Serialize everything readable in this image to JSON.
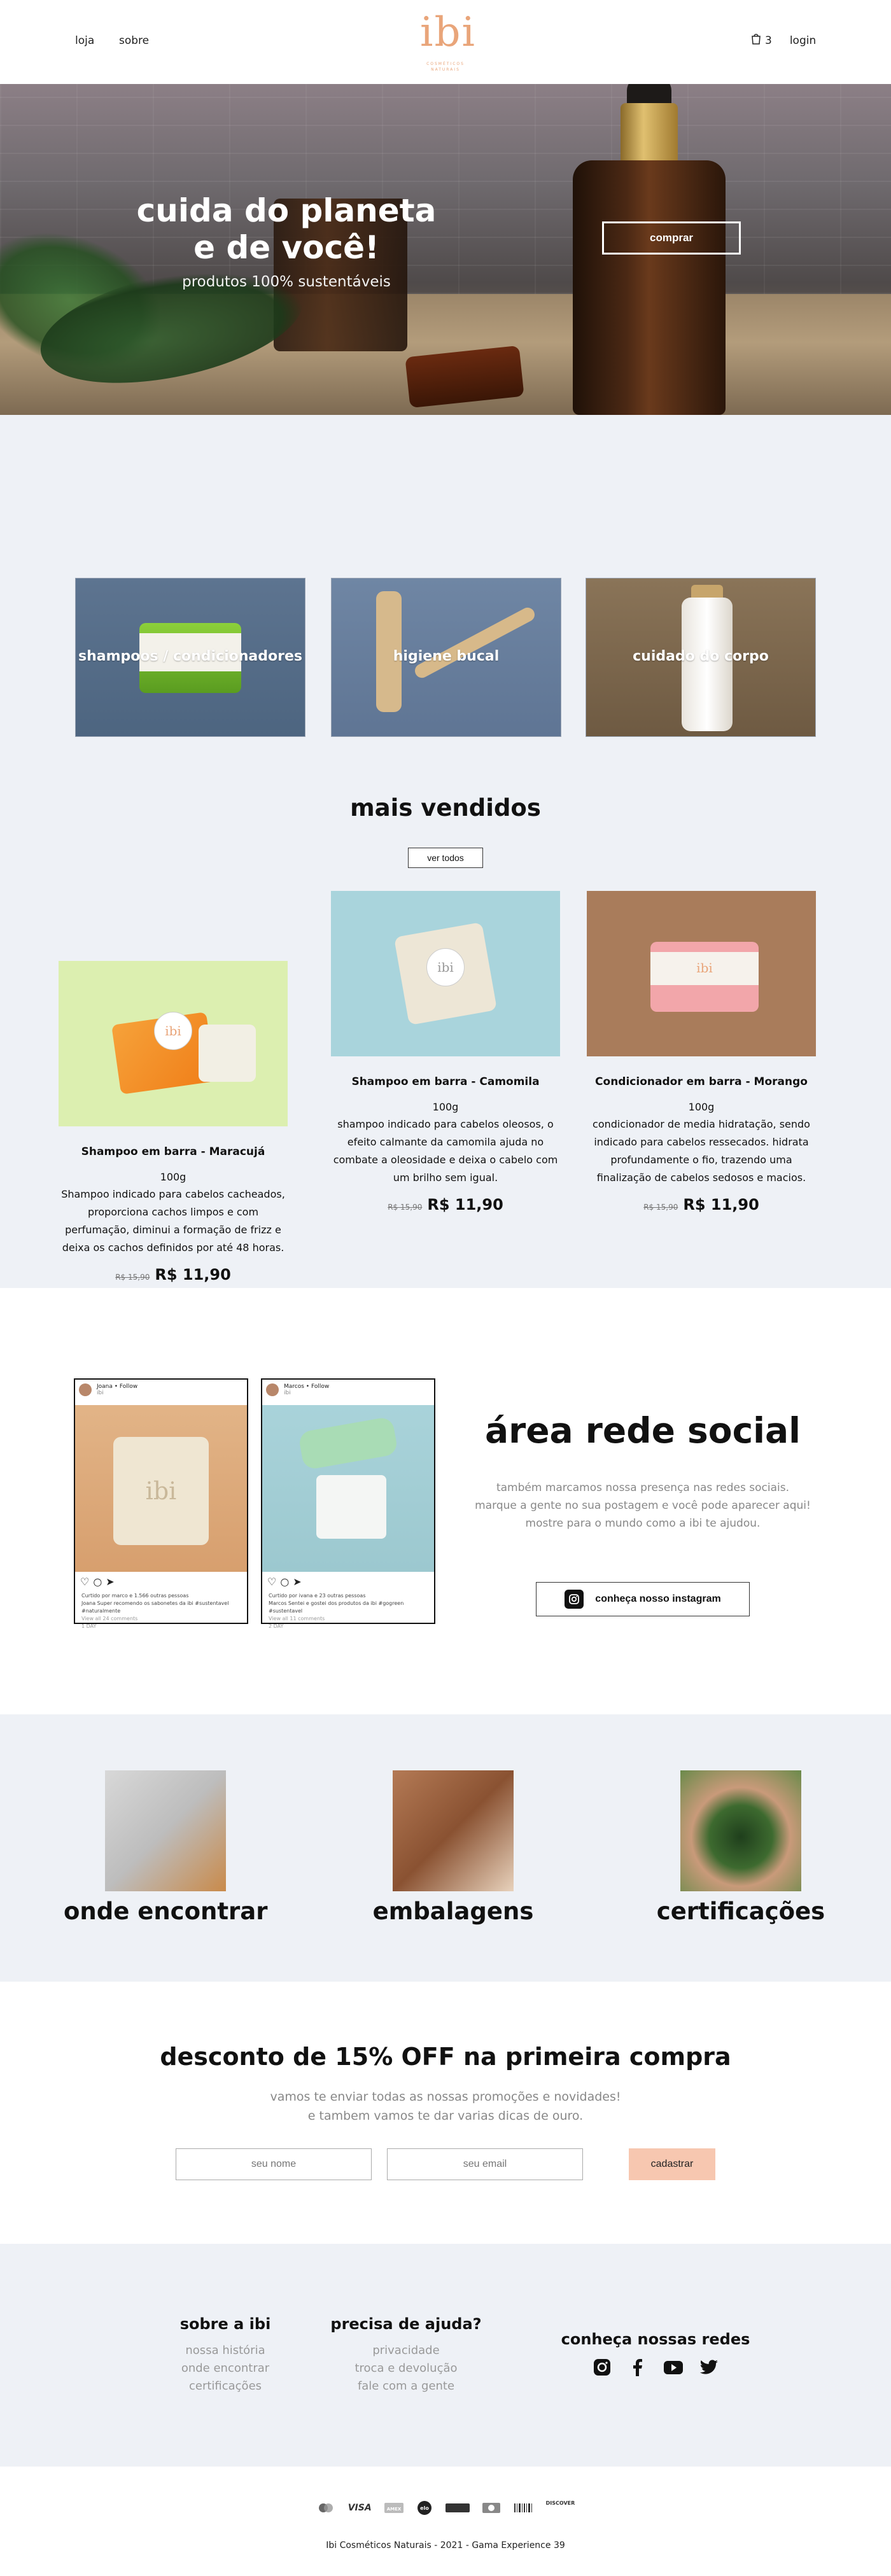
{
  "header": {
    "nav": [
      "loja",
      "sobre"
    ],
    "logo_mark": "ibi",
    "logo_sub": "COSMÉTICOS NATURAIS",
    "cart_count": "3",
    "login": "login"
  },
  "hero": {
    "title_line1": "cuida do planeta",
    "title_line2": "e de você!",
    "subtitle": "produtos 100% sustentáveis",
    "button": "comprar"
  },
  "categories": [
    {
      "label": "shampoos / condicionadores"
    },
    {
      "label": "higiene bucal"
    },
    {
      "label": "cuidado do corpo"
    }
  ],
  "bestsellers": {
    "title": "mais vendidos",
    "button": "ver todos",
    "products": [
      {
        "name": "Shampoo em barra - Maracujá",
        "weight": "100g",
        "desc": "Shampoo indicado para cabelos cacheados, proporciona cachos limpos e com perfumação, diminui a formação de frizz e deixa os cachos definidos por até 48 horas.",
        "old_price": "R$ 15,90",
        "price": "R$ 11,90",
        "tag": "ibi"
      },
      {
        "name": "Shampoo em barra - Camomila",
        "weight": "100g",
        "desc": "shampoo indicado para cabelos oleosos, o efeito calmante da camomila ajuda no combate a oleosidade e deixa o cabelo com um brilho sem igual.",
        "old_price": "R$ 15,90",
        "price": "R$ 11,90",
        "tag": "ibi"
      },
      {
        "name": "Condicionador em barra - Morango",
        "weight": "100g",
        "desc": "condicionador de media hidratação, sendo indicado para cabelos ressecados. hidrata profundamente o fio, trazendo uma finalização de cabelos sedosos e macios.",
        "old_price": "R$ 15,90",
        "price": "R$ 11,90",
        "tag": "ibi"
      }
    ]
  },
  "social": {
    "posts": [
      {
        "user": "Joana • Follow",
        "location": "ibi",
        "likes": "Curtido por marco e 1.566 outras pessoas",
        "caption": "Joana Super recomendo os sabonetes da ibi #sustentavel #naturalmente",
        "comments": "View all 24 comments",
        "time": "1 DAY"
      },
      {
        "user": "Marcos • Follow",
        "location": "ibi",
        "likes": "Curtido por ivana e 23 outras pessoas",
        "caption": "Marcos Sentei e gostei dos produtos da ibi #gogreen #sustentavel",
        "comments": "View all 11 comments",
        "time": "2 DAY"
      }
    ],
    "title": "área rede social",
    "text_line1": "também marcamos nossa presença nas redes sociais.",
    "text_line2": "marque a gente no sua postagem e você pode aparecer aqui!",
    "text_line3": "mostre para o mundo como a ibi te ajudou.",
    "button": "conheça nosso instagram"
  },
  "info": [
    {
      "label": "onde encontrar"
    },
    {
      "label": "embalagens"
    },
    {
      "label": "certificações"
    }
  ],
  "newsletter": {
    "title": "desconto de 15% OFF na primeira compra",
    "line1": "vamos te enviar todas as nossas promoções e novidades!",
    "line2": "e tambem vamos te dar varias dicas de ouro.",
    "name_placeholder": "seu nome",
    "email_placeholder": "seu email",
    "button": "cadastrar"
  },
  "footer": {
    "col1_title": "sobre a ibi",
    "col1_links": [
      "nossa história",
      "onde encontrar",
      "certificações"
    ],
    "col2_title": "precisa de ajuda?",
    "col2_links": [
      "privacidade",
      "troca e devolução",
      "fale com a gente"
    ],
    "col3_title": "conheça nossas redes",
    "social_icons": [
      "instagram-icon",
      "facebook-icon",
      "youtube-icon",
      "twitter-icon"
    ]
  },
  "bottom": {
    "payments": [
      "mastercard",
      "VISA",
      "amex",
      "elo",
      "hipercard",
      "diners",
      "boleto",
      "DISCOVER"
    ],
    "copyright": "Ibi Cosméticos Naturais - 2021 - Gama Experience 39"
  },
  "colors": {
    "accent": "#e9a57a",
    "light_bg": "#eef1f6",
    "cta": "#f7c7b0"
  }
}
